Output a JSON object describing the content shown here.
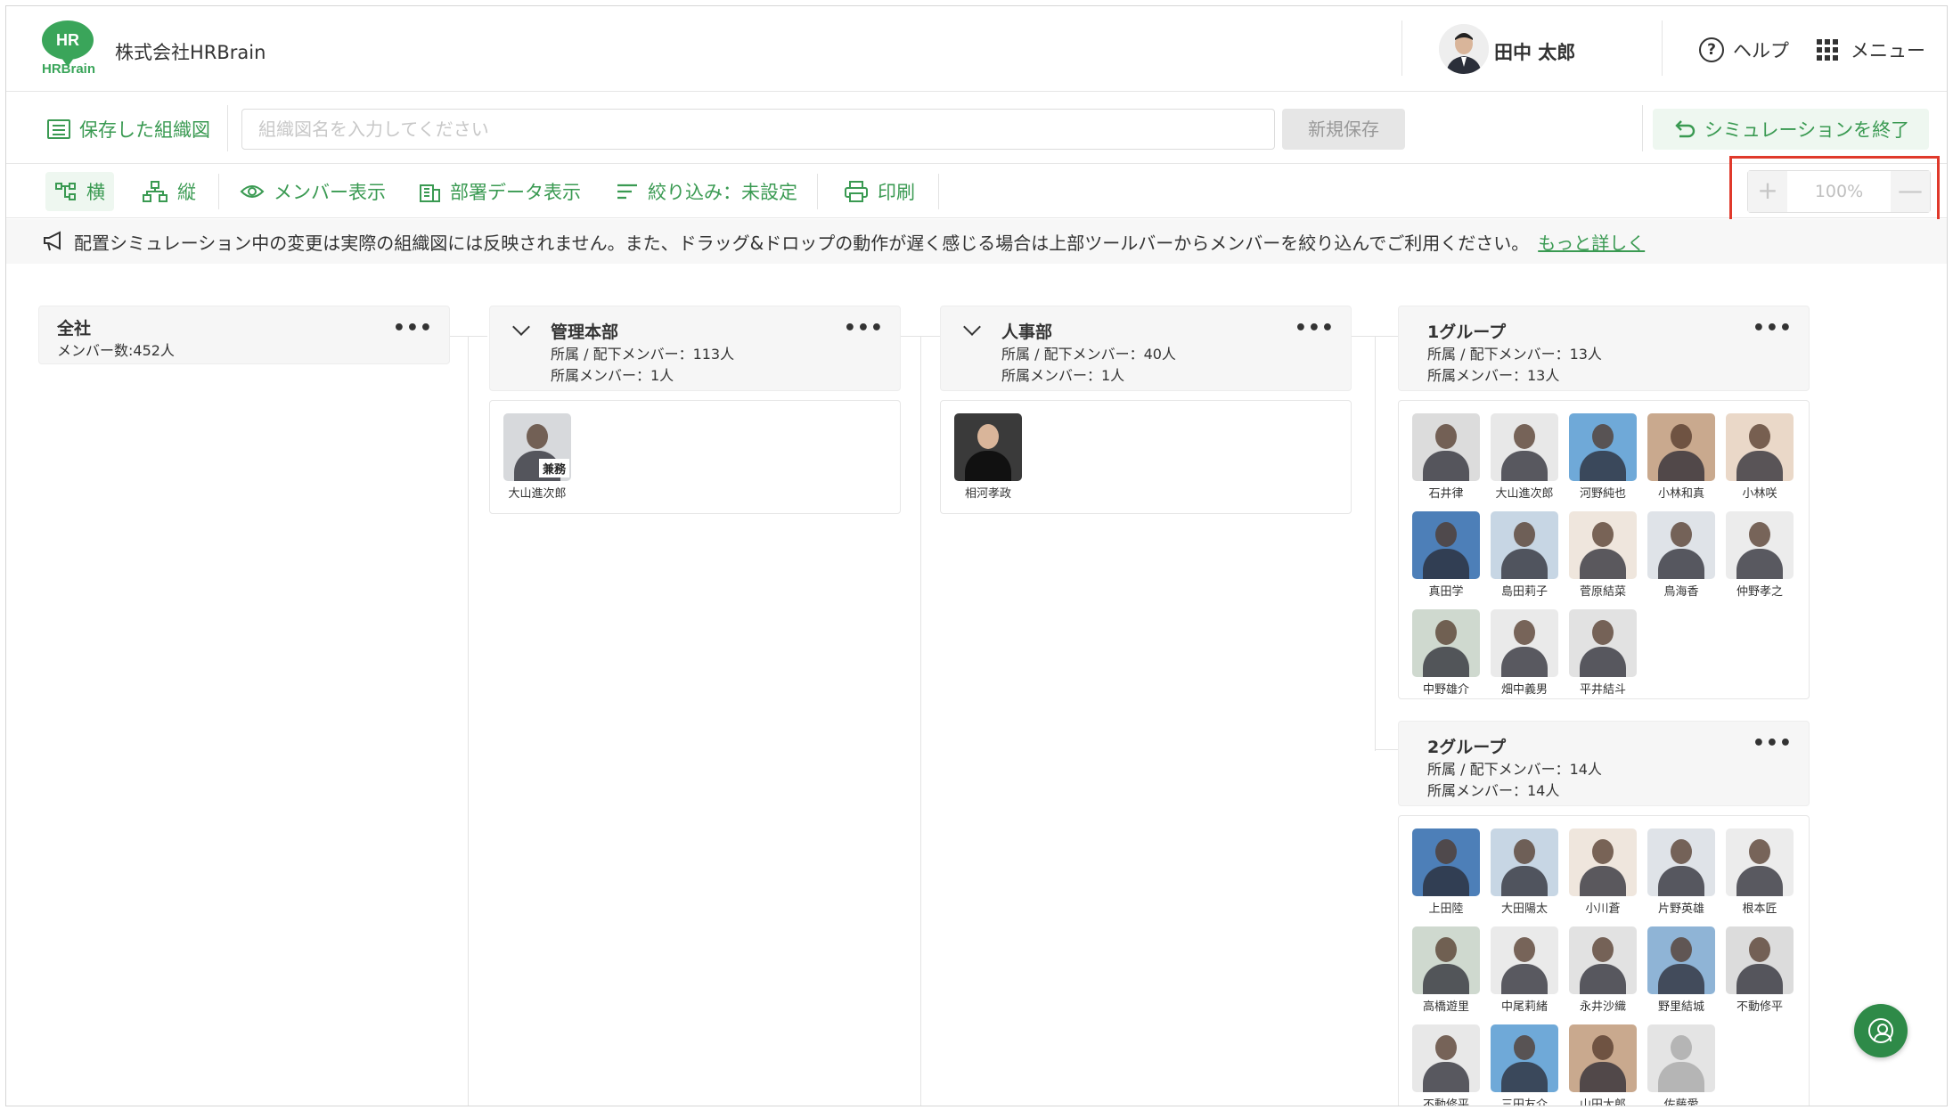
{
  "header": {
    "logo_top": "HR",
    "logo_bottom": "HRBrain",
    "company": "株式会社HRBrain",
    "user_name": "田中 太郎",
    "help_label": "ヘルプ",
    "menu_label": "メニュー"
  },
  "savebar": {
    "saved_label": "保存した組織図",
    "name_placeholder": "組織図名を入力してください",
    "new_save_label": "新規保存",
    "end_sim_label": "シミュレーションを終了"
  },
  "toolbar": {
    "horizontal_label": "横",
    "vertical_label": "縦",
    "member_display_label": "メンバー表示",
    "dept_data_label": "部署データ表示",
    "filter_label": "絞り込み：未設定",
    "print_label": "印刷",
    "zoom_plus": "+",
    "zoom_value": "100%",
    "zoom_minus": "—"
  },
  "notice": {
    "text": "配置シミュレーション中の変更は実際の組織図には反映されません。また、ドラッグ&ドロップの動作が遅く感じる場合は上部ツールバーからメンバーを絞り込んでご利用ください。",
    "link": "もっと詳しく"
  },
  "org": {
    "root": {
      "title": "全社",
      "line1": "メンバー数:452人"
    },
    "kanri": {
      "title": "管理本部",
      "line1": "所属 / 配下メンバー：113人",
      "line2": "所属メンバー：1人",
      "member": "大山進次郎",
      "badge": "兼務"
    },
    "jinji": {
      "title": "人事部",
      "line1": "所属 / 配下メンバー：40人",
      "line2": "所属メンバー：1人",
      "member": "相河孝政"
    },
    "g1": {
      "title": "1グループ",
      "line1": "所属 / 配下メンバー：13人",
      "line2": "所属メンバー：13人",
      "members": [
        "石井律",
        "大山進次郎",
        "河野純也",
        "小林和真",
        "小林咲",
        "真田学",
        "島田莉子",
        "菅原結菜",
        "鳥海香",
        "仲野孝之",
        "中野雄介",
        "畑中義男",
        "平井結斗"
      ]
    },
    "g2": {
      "title": "2グループ",
      "line1": "所属 / 配下メンバー：14人",
      "line2": "所属メンバー：14人",
      "members": [
        "上田陸",
        "大田陽太",
        "小川蒼",
        "片野英雄",
        "根本匠",
        "高橋遊里",
        "中尾莉緒",
        "永井沙織",
        "野里結城",
        "不動修平",
        "不動修平",
        "三田友介",
        "山田太郎",
        "佐藤愛"
      ]
    }
  }
}
